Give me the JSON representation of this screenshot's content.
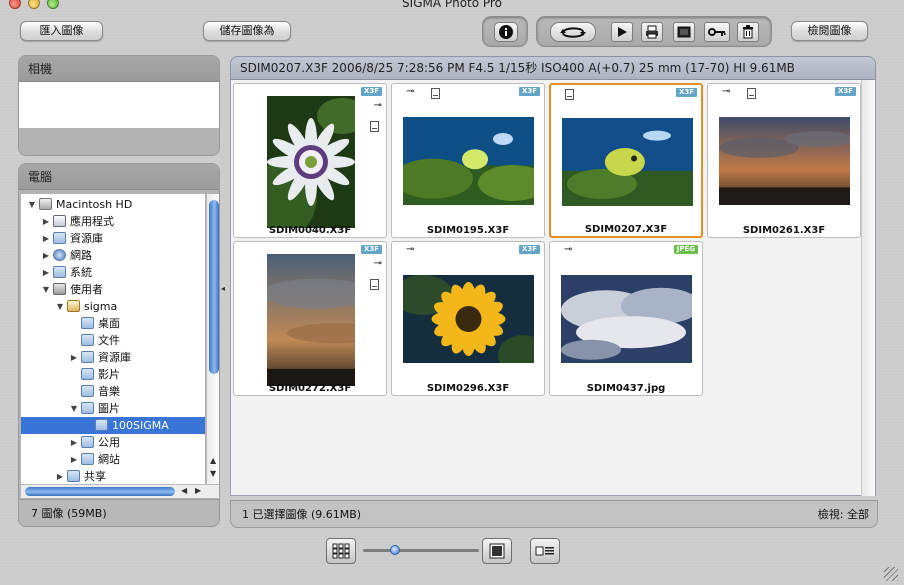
{
  "window": {
    "title": "SIGMA Photo Pro"
  },
  "toolbar": {
    "import_label": "匯入圖像",
    "save_as_label": "儲存圖像為",
    "review_label": "檢閱圖像"
  },
  "camera_panel": {
    "title": "相機"
  },
  "computer_panel": {
    "title": "電腦",
    "tree": [
      {
        "label": "Macintosh HD",
        "icon": "hard-drive-icon",
        "expanded": true
      },
      {
        "label": "應用程式",
        "icon": "applications-folder-icon",
        "expanded": false
      },
      {
        "label": "資源庫",
        "icon": "library-folder-icon",
        "expanded": false
      },
      {
        "label": "網路",
        "icon": "network-icon",
        "expanded": false
      },
      {
        "label": "系統",
        "icon": "system-folder-icon",
        "expanded": false
      },
      {
        "label": "使用者",
        "icon": "users-folder-icon",
        "expanded": true
      },
      {
        "label": "sigma",
        "icon": "home-folder-icon",
        "expanded": true
      },
      {
        "label": "桌面",
        "icon": "desktop-folder-icon"
      },
      {
        "label": "文件",
        "icon": "documents-folder-icon"
      },
      {
        "label": "資源庫",
        "icon": "library-folder-icon",
        "expanded": false
      },
      {
        "label": "影片",
        "icon": "movies-folder-icon"
      },
      {
        "label": "音樂",
        "icon": "music-folder-icon"
      },
      {
        "label": "圖片",
        "icon": "pictures-folder-icon",
        "expanded": true
      },
      {
        "label": "100SIGMA",
        "icon": "folder-icon",
        "selected": true
      },
      {
        "label": "公用",
        "icon": "public-folder-icon",
        "expanded": false
      },
      {
        "label": "網站",
        "icon": "sites-folder-icon",
        "expanded": false
      },
      {
        "label": "共享",
        "icon": "shared-folder-icon",
        "expanded": false
      }
    ],
    "status": "7 圖像 (59MB)"
  },
  "info_bar": {
    "text": "SDIM0207.X3F  2006/8/25 7:28:56 PM F4.5 1/15秒 ISO400 A(+0.7) 25 mm (17-70) HI  9.61MB"
  },
  "thumbnails": [
    {
      "filename": "SDIM0040.X3F",
      "badge": "X3F",
      "locked": true,
      "selected": false,
      "photo": "passion-flower"
    },
    {
      "filename": "SDIM0195.X3F",
      "badge": "X3F",
      "locked": true,
      "selected": false,
      "photo": "reef-fish"
    },
    {
      "filename": "SDIM0207.X3F",
      "badge": "X3F",
      "locked": false,
      "selected": true,
      "photo": "pufferfish"
    },
    {
      "filename": "SDIM0261.X3F",
      "badge": "X3F",
      "locked": true,
      "selected": false,
      "photo": "sunset-sky"
    },
    {
      "filename": "SDIM0272.X3F",
      "badge": "X3F",
      "locked": true,
      "selected": false,
      "photo": "sunset-clouds"
    },
    {
      "filename": "SDIM0296.X3F",
      "badge": "X3F",
      "locked": true,
      "selected": false,
      "photo": "sunflower"
    },
    {
      "filename": "SDIM0437.jpg",
      "badge": "JPEG",
      "locked": true,
      "selected": false,
      "photo": "cloudy-sky"
    }
  ],
  "status_bar": {
    "selection": "1 已選擇圖像 (9.61MB)",
    "view_filter": "檢視: 全部"
  },
  "bottom": {
    "zoom_level": 0.28
  },
  "colors": {
    "selection_blue": "#3875d7",
    "thumb_selected": "#e59025",
    "x3f_badge": "#63a5c8",
    "jpeg_badge": "#6cbf4a"
  }
}
